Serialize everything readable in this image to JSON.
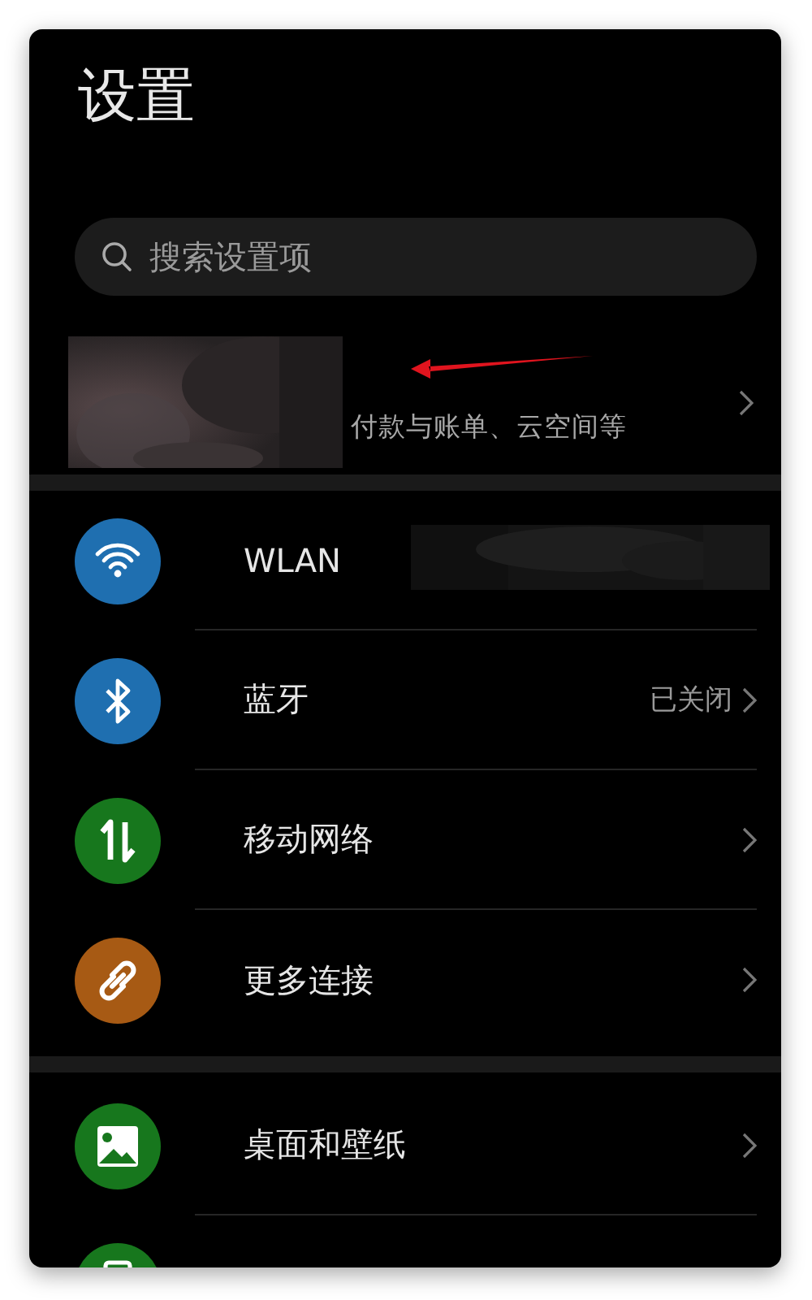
{
  "title": "设置",
  "search": {
    "placeholder": "搜索设置项"
  },
  "account": {
    "subtitle": "付款与账单、云空间等",
    "annotation": {
      "kind": "arrow"
    }
  },
  "groups": [
    {
      "items": [
        {
          "kind": "wifi",
          "color": "#1f6fb0",
          "label": "WLAN"
        },
        {
          "kind": "bluetooth",
          "color": "#1f6fb0",
          "label": "蓝牙",
          "trailing": {
            "kind": "text",
            "text": "已关闭"
          }
        },
        {
          "kind": "mobile",
          "color": "#17771d",
          "label": "移动网络"
        },
        {
          "kind": "link",
          "color": "#a75a14",
          "label": "更多连接"
        }
      ]
    },
    {
      "items": [
        {
          "kind": "wallpaper",
          "color": "#17771d",
          "label": "桌面和壁纸"
        },
        {
          "kind": "display",
          "color": "#17771d"
        }
      ]
    }
  ]
}
